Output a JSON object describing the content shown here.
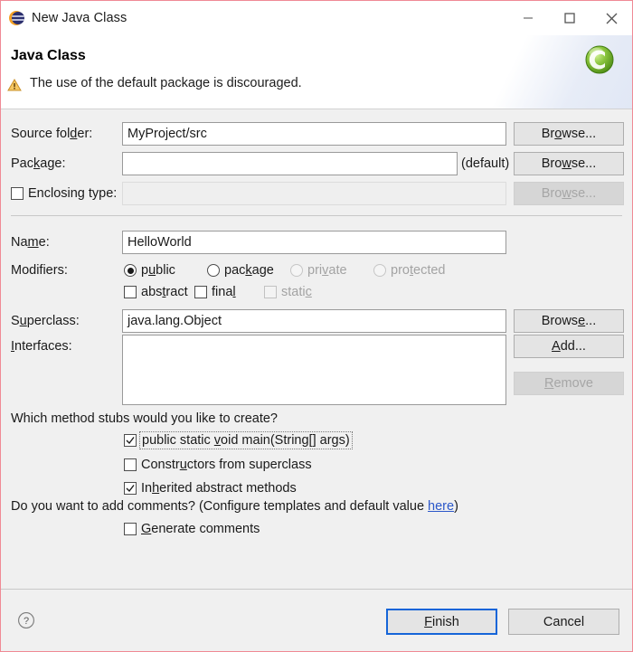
{
  "window": {
    "title": "New Java Class",
    "icon": "java-class-icon",
    "controls": [
      {
        "name": "minimize-button",
        "glyph": "minimize-icon"
      },
      {
        "name": "maximize-button",
        "glyph": "maximize-icon"
      },
      {
        "name": "close-button",
        "glyph": "close-icon"
      }
    ]
  },
  "header": {
    "title": "Java Class",
    "message": "The use of the default package is discouraged.",
    "message_icon": "warning-icon",
    "banner_icon": "java-class-banner-icon",
    "warning_color": "#f0a71e"
  },
  "form": {
    "source_folder": {
      "label_before": "Source fol",
      "label_mnemonic": "d",
      "label_after": "er:",
      "value": "MyProject/src",
      "browse_before": "Br",
      "browse_mnemonic": "o",
      "browse_after": "wse...",
      "browse_enabled": true
    },
    "package": {
      "label_before": "Pac",
      "label_mnemonic": "k",
      "label_after": "age:",
      "value": "",
      "hint": "(default)",
      "browse_before": "Bro",
      "browse_mnemonic": "w",
      "browse_after": "se...",
      "browse_enabled": true
    },
    "enclosing_type": {
      "label": "Enclosing type:",
      "checked": false,
      "enabled": true,
      "value": "",
      "field_enabled": false,
      "browse_before": "Bro",
      "browse_mnemonic": "w",
      "browse_after": "se...",
      "browse_enabled": false
    },
    "name": {
      "label_before": "Na",
      "label_mnemonic": "m",
      "label_after": "e:",
      "value": "HelloWorld"
    },
    "modifiers": {
      "label": "Modifiers:",
      "access": [
        {
          "before": "p",
          "mnemonic": "u",
          "after": "blic",
          "selected": true,
          "enabled": true
        },
        {
          "before": "pac",
          "mnemonic": "k",
          "after": "age",
          "selected": false,
          "enabled": true
        },
        {
          "before": "pri",
          "mnemonic": "v",
          "after": "ate",
          "selected": false,
          "enabled": false
        },
        {
          "before": "pro",
          "mnemonic": "t",
          "after": "ected",
          "selected": false,
          "enabled": false
        }
      ],
      "flags": [
        {
          "before": "abs",
          "mnemonic": "t",
          "after": "ract",
          "checked": false,
          "enabled": true
        },
        {
          "before": "fina",
          "mnemonic": "l",
          "after": "",
          "checked": false,
          "enabled": true
        },
        {
          "before": "stati",
          "mnemonic": "c",
          "after": "",
          "checked": false,
          "enabled": false
        }
      ]
    },
    "superclass": {
      "label_before": "S",
      "label_mnemonic": "u",
      "label_after": "perclass:",
      "value": "java.lang.Object",
      "browse_before": "Brows",
      "browse_mnemonic": "e",
      "browse_after": "...",
      "browse_enabled": true
    },
    "interfaces": {
      "label_before": "",
      "label_mnemonic": "I",
      "label_after": "nterfaces:",
      "value": "",
      "add_before": "",
      "add_mnemonic": "A",
      "add_after": "dd...",
      "add_enabled": true,
      "remove_before": "",
      "remove_mnemonic": "R",
      "remove_after": "emove",
      "remove_enabled": false
    },
    "stubs": {
      "question": "Which method stubs would you like to create?",
      "items": [
        {
          "before": "public static ",
          "mnemonic": "v",
          "after": "oid main(String[] args)",
          "checked": true,
          "enabled": true,
          "focused": true
        },
        {
          "before": "Constr",
          "mnemonic": "u",
          "after": "ctors from superclass",
          "checked": false,
          "enabled": true,
          "focused": false
        },
        {
          "before": "In",
          "mnemonic": "h",
          "after": "erited abstract methods",
          "checked": true,
          "enabled": true,
          "focused": false
        }
      ]
    },
    "comments": {
      "question_prefix": "Do you want to add comments? (Configure templates and default value ",
      "link_text": "here",
      "question_suffix": ")",
      "checkbox": {
        "before": "",
        "mnemonic": "G",
        "after": "enerate comments",
        "checked": false,
        "enabled": true
      }
    }
  },
  "footer": {
    "help_icon": "help-icon",
    "finish": {
      "before": "",
      "mnemonic": "F",
      "after": "inish",
      "is_default": true
    },
    "cancel": {
      "label": "Cancel",
      "is_default": false
    }
  }
}
